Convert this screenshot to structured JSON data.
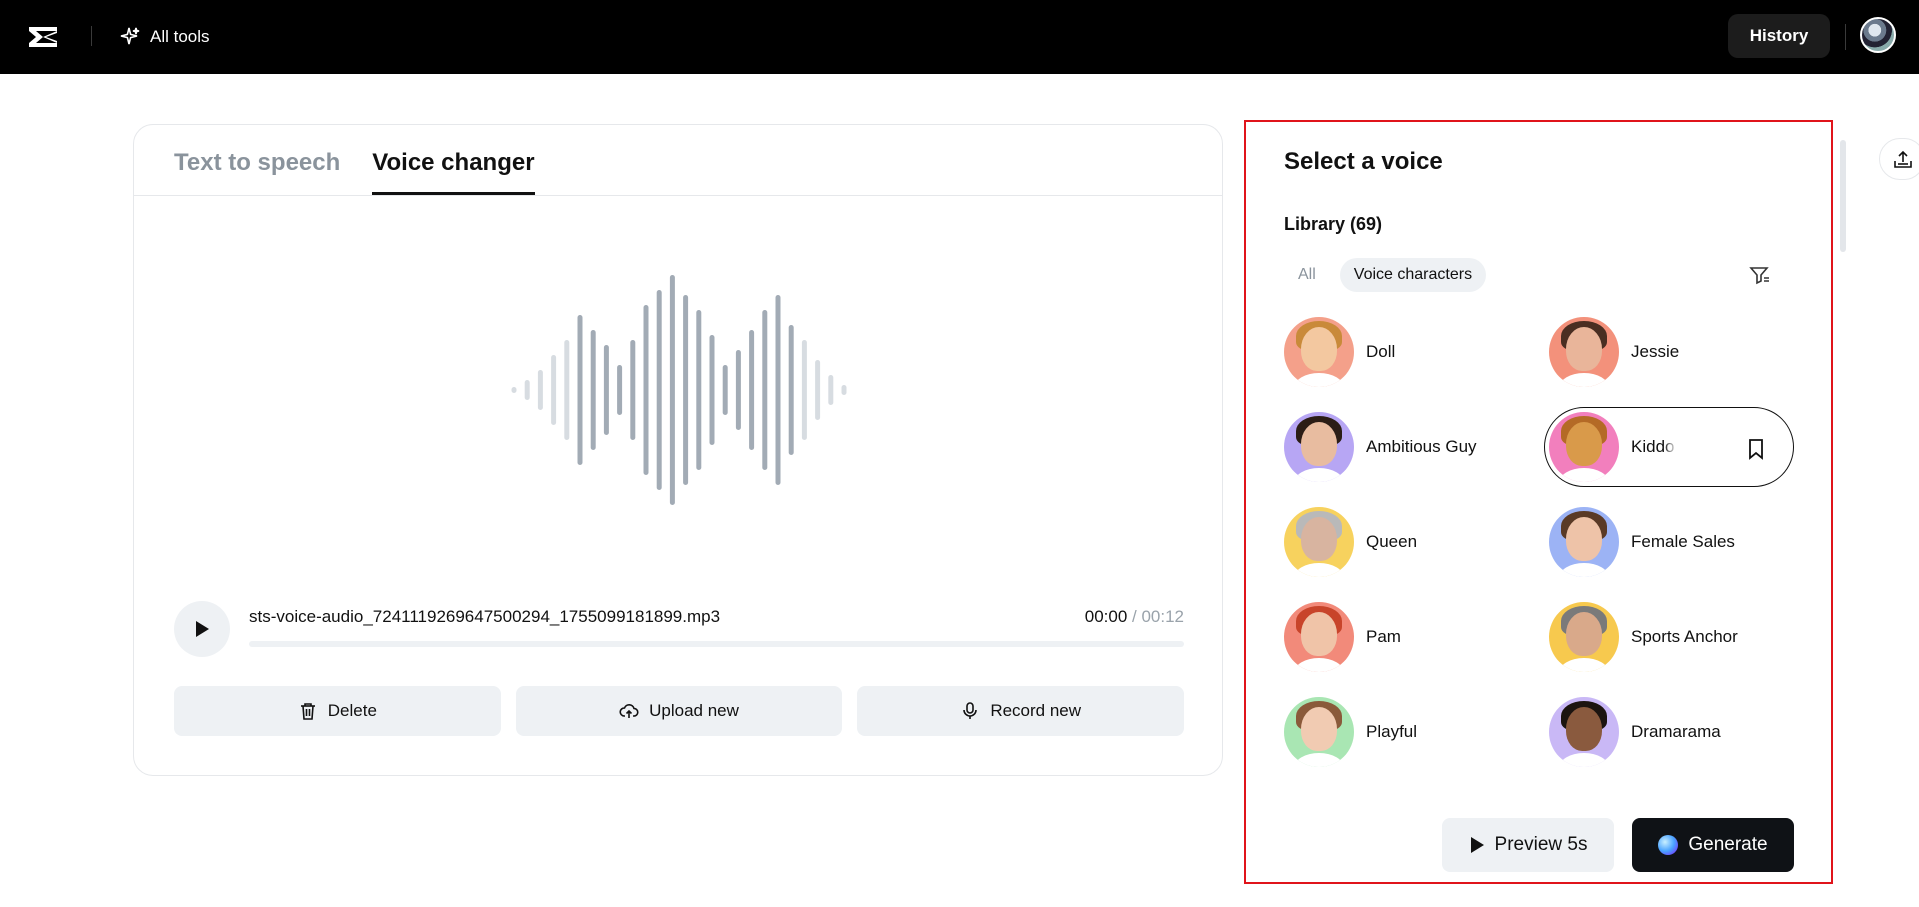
{
  "topbar": {
    "logo_icon": "capcut-logo-icon",
    "all_tools_label": "All tools",
    "history_label": "History",
    "avatar_icon": "user-avatar"
  },
  "tabs": [
    {
      "label": "Text to speech",
      "active": false
    },
    {
      "label": "Voice changer",
      "active": true
    }
  ],
  "player": {
    "filename": "sts-voice-audio_7241119269647500294_1755099181899.mp3",
    "current_time": "00:00",
    "separator": " / ",
    "total_time": "00:12",
    "progress": 0
  },
  "actions": {
    "delete_label": "Delete",
    "upload_label": "Upload new",
    "record_label": "Record new"
  },
  "panel": {
    "title": "Select a voice",
    "library_label": "Library (69)",
    "filters": [
      {
        "label": "All",
        "active": false
      },
      {
        "label": "Voice characters",
        "active": true
      }
    ],
    "voices": [
      {
        "name": "Doll",
        "bg": "#f4a08a",
        "skin": "#f3c8a0",
        "hair": "#c98a3a"
      },
      {
        "name": "Jessie",
        "bg": "#f3917b",
        "skin": "#e9b59a",
        "hair": "#4a2e22"
      },
      {
        "name": "Ambitious Guy",
        "bg": "#b7a6f4",
        "skin": "#e8bca0",
        "hair": "#2b1d16"
      },
      {
        "name": "Kiddo",
        "bg": "#f27fbd",
        "skin": "#d99a4a",
        "hair": "#b46a26",
        "selected": true
      },
      {
        "name": "Queen",
        "bg": "#f7d25e",
        "skin": "#d8b4a0",
        "hair": "#b9b9b9"
      },
      {
        "name": "Female Sales",
        "bg": "#9cb3f5",
        "skin": "#eec3a8",
        "hair": "#5a3a26"
      },
      {
        "name": "Pam",
        "bg": "#f28a7a",
        "skin": "#f0c4a8",
        "hair": "#c8442a"
      },
      {
        "name": "Sports Anchor",
        "bg": "#f7c94e",
        "skin": "#d9a98a",
        "hair": "#7a7a7a"
      },
      {
        "name": "Playful",
        "bg": "#a9e6b3",
        "skin": "#f1cbb2",
        "hair": "#8a5a3a"
      },
      {
        "name": "Dramarama",
        "bg": "#c9b8f6",
        "skin": "#8a5a3e",
        "hair": "#1c1410"
      }
    ],
    "preview_label": "Preview 5s",
    "generate_label": "Generate"
  }
}
